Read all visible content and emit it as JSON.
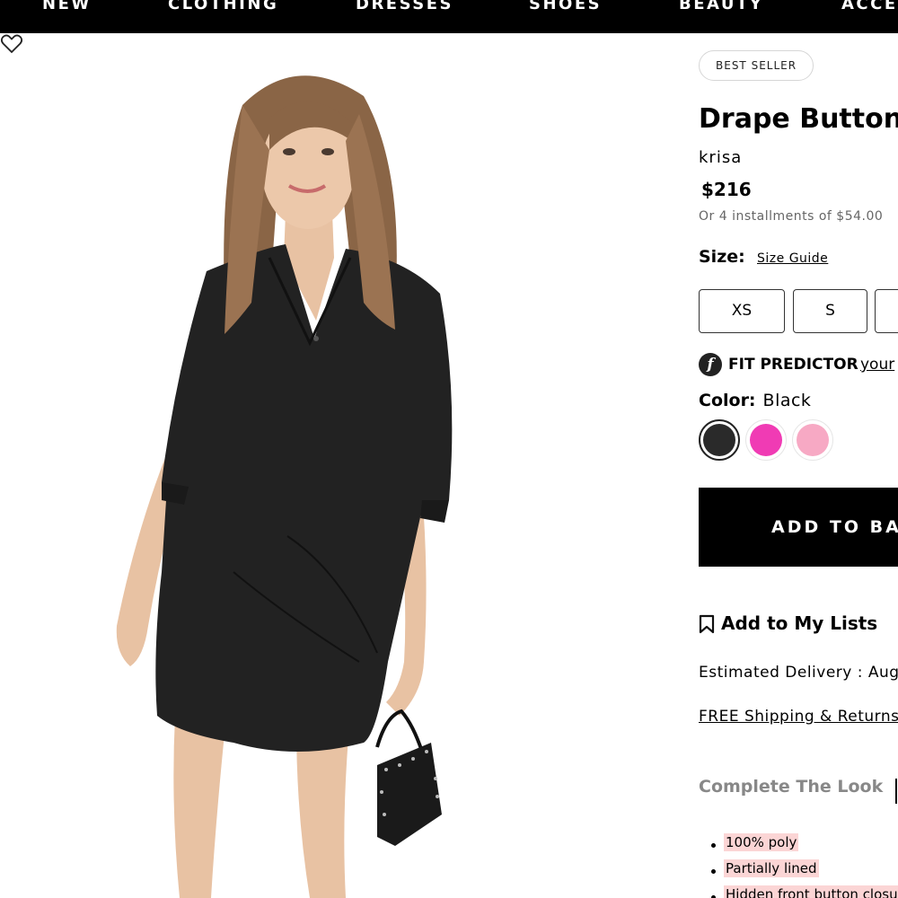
{
  "nav": {
    "items": [
      "NEW",
      "CLOTHING",
      "DRESSES",
      "SHOES",
      "BEAUTY",
      "ACCE"
    ]
  },
  "image": {
    "alt_icon": "product-photo-model-in-black-shirt-dress",
    "wishlist_icon": "heart-outline-icon"
  },
  "product": {
    "badge": "BEST SELLER",
    "title": "Drape Button",
    "brand": "krisa",
    "price": "$216",
    "installments": "Or 4 installments of $54.00"
  },
  "size": {
    "label": "Size:",
    "guide": "Size Guide",
    "options": [
      "XS",
      "S",
      ""
    ]
  },
  "fit": {
    "logo": "f",
    "label": "FIT PREDICTOR",
    "link": "your"
  },
  "color": {
    "label": "Color:",
    "value": "Black",
    "swatches": [
      {
        "name": "Black",
        "hex": "#2a2a2a",
        "selected": true
      },
      {
        "name": "Hot Pink",
        "hex": "#f03bb4",
        "selected": false
      },
      {
        "name": "Light Pink",
        "hex": "#f7a9c4",
        "selected": false
      }
    ]
  },
  "actions": {
    "add_to_bag": "ADD TO BAG",
    "add_to_lists": "Add to My Lists"
  },
  "delivery": {
    "estimated": "Estimated Delivery : Aug",
    "shipping": "FREE Shipping & Returns"
  },
  "complete_look": {
    "label": "Complete The Look"
  },
  "details": {
    "bullets": [
      "100% poly",
      "Partially lined",
      "Hidden front button closure"
    ]
  },
  "colors": {
    "nav_bg": "#000000",
    "button_bg": "#000000",
    "highlight": "#fbd5d5"
  }
}
